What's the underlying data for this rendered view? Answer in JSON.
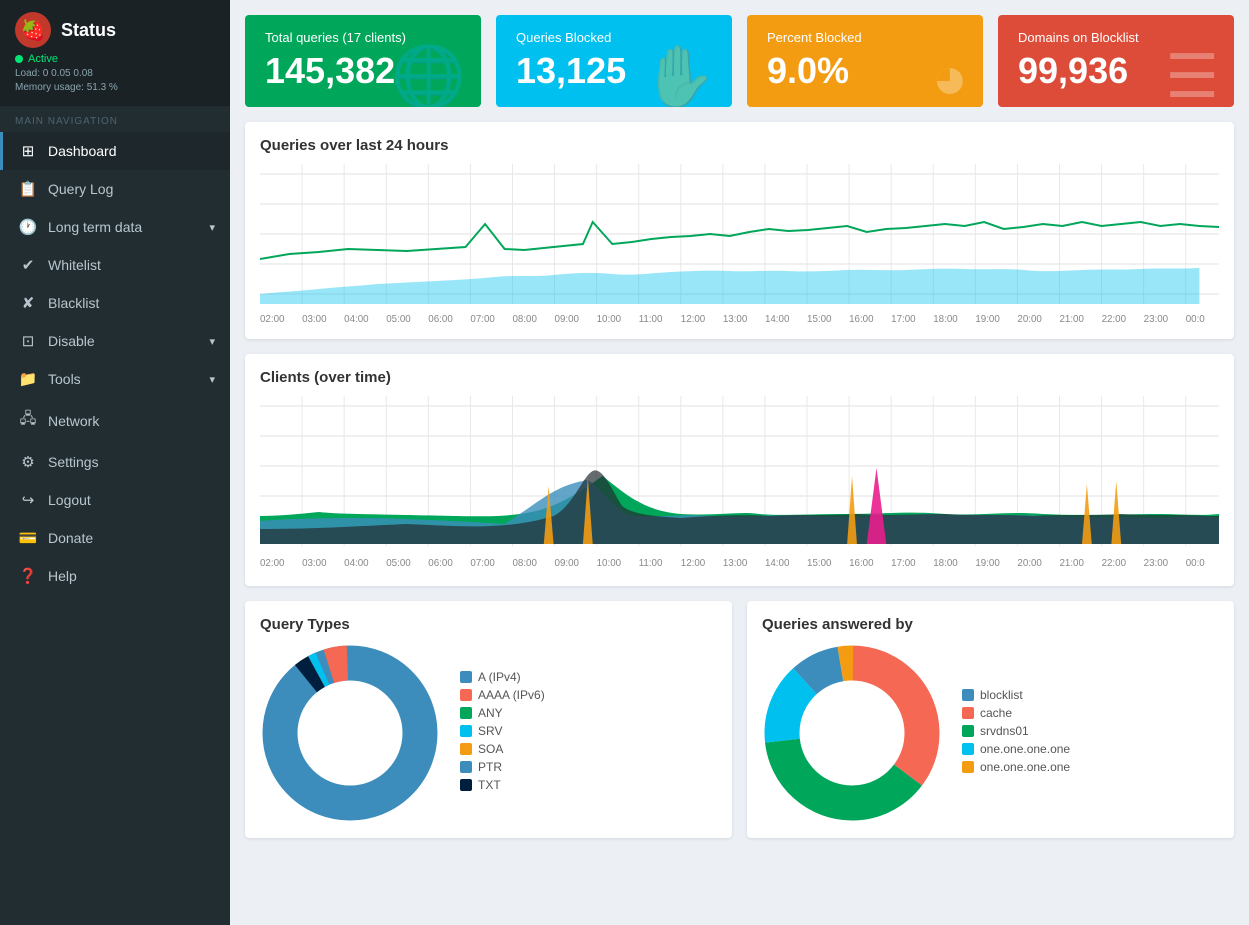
{
  "sidebar": {
    "app_title": "Status",
    "status_label": "Active",
    "load_label": "Load: 0 0.05 0.08",
    "memory_label": "Memory usage: 51.3 %",
    "nav_label": "MAIN NAVIGATION",
    "items": [
      {
        "id": "dashboard",
        "label": "Dashboard",
        "icon": "⊞",
        "active": true,
        "has_chevron": false
      },
      {
        "id": "query-log",
        "label": "Query Log",
        "icon": "📄",
        "active": false,
        "has_chevron": false
      },
      {
        "id": "long-term-data",
        "label": "Long term data",
        "icon": "🕐",
        "active": false,
        "has_chevron": true
      },
      {
        "id": "whitelist",
        "label": "Whitelist",
        "icon": "✔",
        "active": false,
        "has_chevron": false
      },
      {
        "id": "blacklist",
        "label": "Blacklist",
        "icon": "✘",
        "active": false,
        "has_chevron": false
      },
      {
        "id": "disable",
        "label": "Disable",
        "icon": "⊡",
        "active": false,
        "has_chevron": true
      },
      {
        "id": "tools",
        "label": "Tools",
        "icon": "📁",
        "active": false,
        "has_chevron": true
      },
      {
        "id": "network",
        "label": "Network",
        "icon": "🖧",
        "active": false,
        "has_chevron": false
      },
      {
        "id": "settings",
        "label": "Settings",
        "icon": "⚙",
        "active": false,
        "has_chevron": false
      },
      {
        "id": "logout",
        "label": "Logout",
        "icon": "⬡",
        "active": false,
        "has_chevron": false
      },
      {
        "id": "donate",
        "label": "Donate",
        "icon": "💳",
        "active": false,
        "has_chevron": false
      },
      {
        "id": "help",
        "label": "Help",
        "icon": "❓",
        "active": false,
        "has_chevron": false
      }
    ]
  },
  "stat_cards": [
    {
      "id": "total-queries",
      "label": "Total queries (17 clients)",
      "value": "145,382",
      "color": "green",
      "icon": "🌐"
    },
    {
      "id": "queries-blocked",
      "label": "Queries Blocked",
      "value": "13,125",
      "color": "blue",
      "icon": "✋"
    },
    {
      "id": "percent-blocked",
      "label": "Percent Blocked",
      "value": "9.0%",
      "color": "orange",
      "icon": "🥧"
    },
    {
      "id": "domains-blocklist",
      "label": "Domains on Blocklist",
      "value": "99,936",
      "color": "red",
      "icon": "☰"
    }
  ],
  "charts": {
    "queries_over_time": {
      "title": "Queries over last 24 hours",
      "x_labels": [
        "02:00",
        "03:00",
        "04:00",
        "05:00",
        "06:00",
        "07:00",
        "08:00",
        "09:00",
        "10:00",
        "11:00",
        "12:00",
        "13:00",
        "14:00",
        "15:00",
        "16:00",
        "17:00",
        "18:00",
        "19:00",
        "20:00",
        "21:00",
        "22:00",
        "23:00",
        "00:0"
      ]
    },
    "clients_over_time": {
      "title": "Clients (over time)",
      "x_labels": [
        "02:00",
        "03:00",
        "04:00",
        "05:00",
        "06:00",
        "07:00",
        "08:00",
        "09:00",
        "10:00",
        "11:00",
        "12:00",
        "13:00",
        "14:00",
        "15:00",
        "16:00",
        "17:00",
        "18:00",
        "19:00",
        "20:00",
        "21:00",
        "22:00",
        "23:00",
        "00:0"
      ]
    }
  },
  "query_types": {
    "title": "Query Types",
    "legend": [
      {
        "label": "A (IPv4)",
        "color": "#3c8dbc"
      },
      {
        "label": "AAAA (IPv6)",
        "color": "#f56954"
      },
      {
        "label": "ANY",
        "color": "#00a65a"
      },
      {
        "label": "SRV",
        "color": "#00c0ef"
      },
      {
        "label": "SOA",
        "color": "#f39c12"
      },
      {
        "label": "PTR",
        "color": "#3c8dbc"
      },
      {
        "label": "TXT",
        "color": "#001f3f"
      }
    ],
    "segments": [
      {
        "pct": 88,
        "color": "#3c8dbc"
      },
      {
        "pct": 3,
        "color": "#f56954"
      },
      {
        "pct": 1,
        "color": "#e74c3c"
      },
      {
        "pct": 1,
        "color": "#00c0ef"
      },
      {
        "pct": 1,
        "color": "#f39c12"
      },
      {
        "pct": 4,
        "color": "#3c8dbc"
      },
      {
        "pct": 2,
        "color": "#001f3f"
      }
    ]
  },
  "queries_answered_by": {
    "title": "Queries answered by",
    "legend": [
      {
        "label": "blocklist",
        "color": "#3c8dbc"
      },
      {
        "label": "cache",
        "color": "#f56954"
      },
      {
        "label": "srvdns01",
        "color": "#00a65a"
      },
      {
        "label": "one.one.one.one",
        "color": "#00c0ef"
      },
      {
        "label": "one.one.one.one",
        "color": "#f39c12"
      }
    ],
    "segments": [
      {
        "pct": 9,
        "color": "#3c8dbc"
      },
      {
        "pct": 35,
        "color": "#f56954"
      },
      {
        "pct": 38,
        "color": "#00a65a"
      },
      {
        "pct": 15,
        "color": "#00c0ef"
      },
      {
        "pct": 3,
        "color": "#f39c12"
      }
    ]
  }
}
